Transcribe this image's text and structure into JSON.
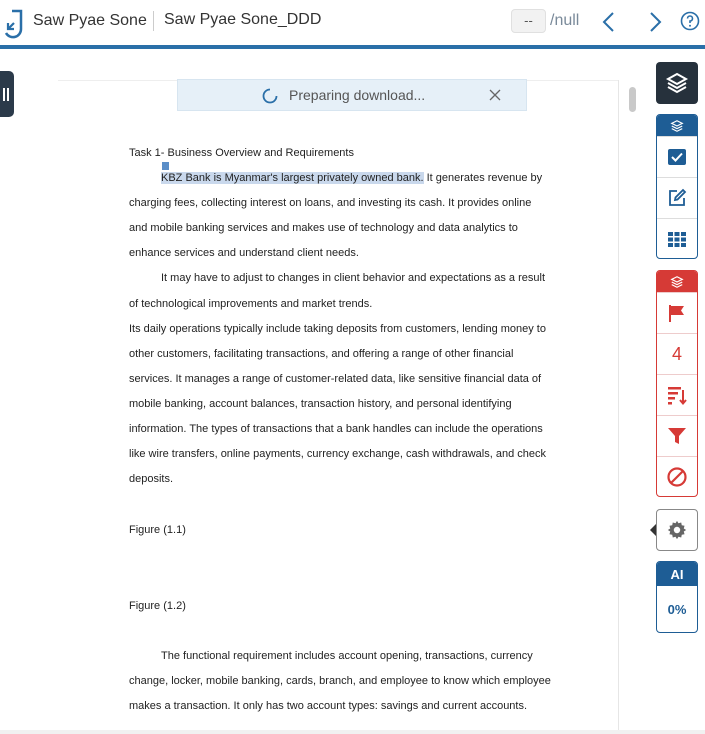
{
  "header": {
    "student_name": "Saw Pyae Sone",
    "document_title": "Saw Pyae Sone_DDD",
    "page_current": "--",
    "page_total": "/null"
  },
  "toast": {
    "message": "Preparing download..."
  },
  "document": {
    "heading": "Task 1- Business Overview and Requirements",
    "lines": [
      {
        "highlighted": "KBZ Bank is Myanmar's largest privately owned bank.",
        "rest": " It generates revenue by",
        "indent": true
      },
      {
        "text": "charging fees, collecting interest on loans, and investing its cash. It provides online",
        "indent": false
      },
      {
        "text": "and mobile banking services and makes use of technology and data analytics to",
        "indent": false
      },
      {
        "text": "enhance services and understand client needs.",
        "indent": false
      },
      {
        "text": "It may have to adjust to changes in client behavior and expectations as a result",
        "indent": true
      },
      {
        "text": "of technological improvements and market trends.",
        "indent": false
      },
      {
        "text": "Its daily operations typically include taking deposits from customers, lending money to",
        "indent": false
      },
      {
        "text": "other customers, facilitating transactions, and offering a range of other financial",
        "indent": false
      },
      {
        "text": "services. It manages a range of customer-related data, like sensitive financial data of",
        "indent": false
      },
      {
        "text": "mobile banking, account balances, transaction history, and personal identifying",
        "indent": false
      },
      {
        "text": "information. The types of transactions that a bank handles can include the operations",
        "indent": false
      },
      {
        "text": "like wire transfers, online payments, currency exchange, cash withdrawals, and check",
        "indent": false
      },
      {
        "text": "deposits.",
        "indent": false
      }
    ],
    "figure1": "Figure (1.1)",
    "figure2": "Figure (1.2)",
    "lines2": [
      {
        "text": "The functional requirement includes account opening, transactions, currency",
        "indent": true
      },
      {
        "text": "change, locker, mobile banking, cards, branch, and employee to know which employee",
        "indent": false
      },
      {
        "text": "makes a transaction. It only has two account types: savings and current accounts.",
        "indent": false
      }
    ]
  },
  "rail": {
    "flag_count": "4",
    "ai_label": "AI",
    "ai_percent": "0%"
  },
  "colors": {
    "brand_blue": "#1e5d95",
    "alert_red": "#d63a36",
    "dark": "#26313c",
    "highlight": "#c9d8ec"
  }
}
